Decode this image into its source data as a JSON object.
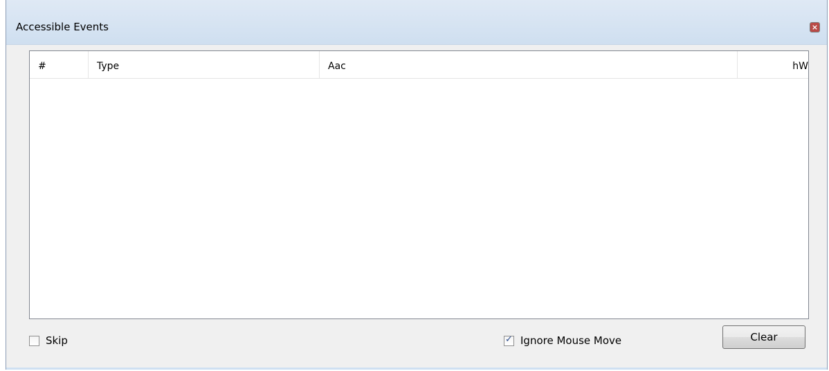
{
  "window": {
    "title": "Accessible Events",
    "close_icon": "close-icon",
    "close_glyph": "×"
  },
  "listview": {
    "columns": [
      {
        "label": "#"
      },
      {
        "label": "Type"
      },
      {
        "label": "Aac"
      },
      {
        "label": "hW"
      }
    ],
    "rows": []
  },
  "options": {
    "skip_label": "Skip",
    "skip_checked": false,
    "ignore_mouse_move_label": "Ignore Mouse Move",
    "ignore_mouse_move_checked": true
  },
  "buttons": {
    "clear_label": "Clear"
  }
}
